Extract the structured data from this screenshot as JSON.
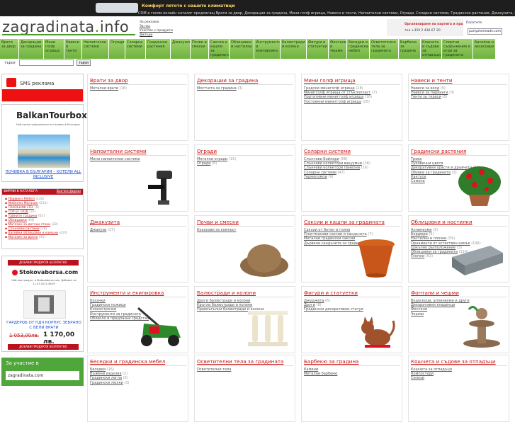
{
  "topbar": {
    "promo": "Комфорт лятото с нашите климатици",
    "strip": "COM е голям онлайн каталог предлагащ Врати за двор, Декорации за градина, Мини голф игрища, Навеси и тенти, Напоителни системи, Огради, Соларни системи, Градински растения, Джакузита, Почви и смески, Саксии и к"
  },
  "logo": {
    "main": "zagradinata",
    "dot": ".",
    "tld": "info"
  },
  "toplinks": [
    "За реклама",
    "За нас",
    "Участие с продукти",
    "Дилъри"
  ],
  "banner": {
    "t1": "Организиране на партита и празненства",
    "t2": "тел.+359 2 436 67 20",
    "r1": "Посетете",
    "r2": "partyzinemade.com"
  },
  "nav": [
    "Врати за двор",
    "Декорации за градина",
    "Мини голф игрища",
    "Навеси и тенти",
    "Напоителни системи",
    "Огради",
    "Соларни системи",
    "Градински растения",
    "Джакузита",
    "Почви и смески",
    "Саксии и кашпи за градината",
    "Облицовки и настилки",
    "Инструменти и екипировка",
    "Балюстради и колони",
    "Фигури и статуетки",
    "Фонтани и чешми",
    "Беседки и градинска мебел",
    "Осветителни тела за градината",
    "Барбекю за градина",
    "Кошчета и съдове за отпадъци",
    "Спортни съоръжения и игри за градината",
    "Басейни и аксесоари"
  ],
  "search": {
    "label": "търси",
    "button": "търси",
    "value": ""
  },
  "sidebar": {
    "sms": "SMS реклама",
    "balkan_title": "BalkanTourbox",
    "balkan_sub": "Най-ниски предложения на почивки в България",
    "balkan_link": "ПОЧИВКА В БЪЛГАРИЯ – ХОТЕЛИ ALL INCLUSIVE",
    "firms_head": "ФИРМИ В КАТАЛОГА",
    "firms_all": "Всички фирми",
    "firms": [
      {
        "name": "Перфект Мебел",
        "count": "(140)"
      },
      {
        "name": "Мебелен Магазин",
        "count": "(214)"
      },
      {
        "name": "TRADELINK LTD.",
        "count": "(8)"
      },
      {
        "name": "ТОР БГ ООД",
        "count": "(37)"
      },
      {
        "name": "Тайните градина",
        "count": "(65)"
      },
      {
        "name": "Облицовки",
        "count": "(64)"
      },
      {
        "name": "Магазин за детски стоки",
        "count": "(28)"
      },
      {
        "name": "Слънчеви системи",
        "count": "(28)"
      },
      {
        "name": "Басейни облицовки и камъни",
        "count": "(437)"
      },
      {
        "name": "Магазин за врати",
        "count": "(35)"
      }
    ],
    "stoko_btn": "ДОБАВИ ПРОДУКТИ БЕЗПЛАТНО",
    "stoko_logo": "Stokovaborsa.com",
    "stoko_sub": "Най-нов продукт в Stokovaborsa.com. Добавен на 11.07.2011 08:09",
    "stoko_title": "ГАРДЕРОБ ОТ ПДЧ КОРПУС ЗЕБРАНО С БЕЛИ ВРАТИ",
    "stoko_old": "1 053,00лв.",
    "stoko_new": "1 170,00 лв.",
    "stoko_btn2": "ДОБАВИ ПРОДУКТИ БЕЗПЛАТНО",
    "fb_title": "За участие в",
    "fb_box": "zagradinata.com"
  },
  "cards": [
    {
      "title": "Врати за двор",
      "items": [
        {
          "n": "Метални врати",
          "c": "(18)"
        }
      ]
    },
    {
      "title": "Декорации за градина",
      "items": [
        {
          "n": "Мостчета за градина",
          "c": "(3)"
        }
      ]
    },
    {
      "title": "Мини голф игрища",
      "items": [
        {
          "n": "Градски миниголф игрища",
          "c": "(28)"
        },
        {
          "n": "Минигголф игрища от стъклопласт",
          "c": "(7)"
        },
        {
          "n": "Портативни минигголф игрища",
          "c": "(16)"
        },
        {
          "n": "Постоянни минигголф игрища",
          "c": "(25)"
        }
      ]
    },
    {
      "title": "Навеси и тенти",
      "items": [
        {
          "n": "Навеси за вход",
          "c": "(5)"
        },
        {
          "n": "Навеси за паркинги",
          "c": "(3)"
        },
        {
          "n": "Тенти за тераси",
          "c": "(8)"
        }
      ]
    },
    {
      "title": "Напоителни системи",
      "items": [
        {
          "n": "Мини напоителни системи",
          "c": ""
        }
      ]
    },
    {
      "title": "Огради",
      "items": [
        {
          "n": "Метални огради",
          "c": "(15)"
        },
        {
          "n": "Огради",
          "c": "(8)"
        }
      ]
    },
    {
      "title": "Соларни системи",
      "items": [
        {
          "n": "Слънчеви Бойлери",
          "c": "(56)"
        },
        {
          "n": "Слънчеви колектори вакуумни",
          "c": "(38)"
        },
        {
          "n": "Слънчеви колектори панелни",
          "c": "(16)"
        },
        {
          "n": "Соларни системи",
          "c": "(47)"
        },
        {
          "n": "Термопомпи",
          "c": "(9)"
        }
      ]
    },
    {
      "title": "Градински растения",
      "items": [
        {
          "n": "Трева",
          "c": ""
        },
        {
          "n": "Луковични цветя",
          "c": ""
        },
        {
          "n": "Декоративни храсти и дръвчета",
          "c": "(14)"
        },
        {
          "n": "Обувки за градината",
          "c": "(3)"
        },
        {
          "n": "Кактуси",
          "c": ""
        },
        {
          "n": "Семена",
          "c": ""
        }
      ]
    },
    {
      "title": "Джакузита",
      "items": [
        {
          "n": "Джакузи",
          "c": "(27)"
        }
      ]
    },
    {
      "title": "Почви и смески",
      "items": [
        {
          "n": "Кокосови за компост",
          "c": ""
        }
      ]
    },
    {
      "title": "Саксии и кашпи за градината",
      "items": [
        {
          "n": "Саксии от бетон и глина",
          "c": ""
        },
        {
          "n": "Пластмасови саксии и сандъчета",
          "c": "(7)"
        },
        {
          "n": "Метални градински саксии",
          "c": ""
        },
        {
          "n": "Дървени сандъчета за градината",
          "c": ""
        }
      ]
    },
    {
      "title": "Облицовки и настилки",
      "items": [
        {
          "n": "Алпинеуми",
          "c": "(3)"
        },
        {
          "n": "Бордюри",
          "c": "(5)"
        },
        {
          "n": "Настилки и плочки",
          "c": "(59)"
        },
        {
          "n": "Орнаменти от естествен камък",
          "c": "(196)"
        },
        {
          "n": "Цокълно разположение",
          "c": "(3)"
        },
        {
          "n": "Облицовки за градината",
          "c": "(114)"
        },
        {
          "n": "Плочки",
          "c": "(92)"
        }
      ]
    },
    {
      "title": "Инструменти и екипировка",
      "items": [
        {
          "n": "Косачки",
          "c": ""
        },
        {
          "n": "Градински ножици",
          "c": ""
        },
        {
          "n": "Клонострачки",
          "c": ""
        },
        {
          "n": "Инструменти за градината",
          "c": ""
        },
        {
          "n": "Облекло и предпазни средства",
          "c": ""
        }
      ]
    },
    {
      "title": "Балюстради и колони",
      "items": [
        {
          "n": "Други Балюстради и колони",
          "c": ""
        },
        {
          "n": "Кръгли балюстради и колони",
          "c": ""
        },
        {
          "n": "Правоъгълни балюстради и колони",
          "c": ""
        }
      ]
    },
    {
      "title": "Фигури и статуетки",
      "items": [
        {
          "n": "Джуджета",
          "c": "(6)"
        },
        {
          "n": "Други",
          "c": "(8)"
        },
        {
          "n": "Градински декоративни статуи",
          "c": ""
        }
      ]
    },
    {
      "title": "Фонтани и чешми",
      "items": [
        {
          "n": "Водоскоци, алпинеуми и други",
          "c": ""
        },
        {
          "n": "Декоративни кладенци",
          "c": ""
        },
        {
          "n": "Фонтани",
          "c": ""
        },
        {
          "n": "Чешми",
          "c": ""
        }
      ]
    },
    {
      "title": "Беседки и градинска мебел",
      "items": [
        {
          "n": "Беседки",
          "c": "(16)"
        },
        {
          "n": "Въжени изделия",
          "c": "(2)"
        },
        {
          "n": "Градински легла",
          "c": "(5)"
        },
        {
          "n": "Градински люлки",
          "c": "(3)"
        }
      ]
    },
    {
      "title": "Осветителни тела за градината",
      "items": [
        {
          "n": "Осветителни тела",
          "c": ""
        }
      ]
    },
    {
      "title": "Барбекю за градина",
      "items": [
        {
          "n": "Камини",
          "c": ""
        },
        {
          "n": "Метални барбекю",
          "c": ""
        }
      ]
    },
    {
      "title": "Кошчета и съдове за отпадъци",
      "items": [
        {
          "n": "Кошчета за отпадъци",
          "c": ""
        },
        {
          "n": "Компостери",
          "c": ""
        },
        {
          "n": "Силози",
          "c": ""
        }
      ]
    }
  ],
  "colors": {
    "nav": "#7cc047",
    "accent": "#c8140f",
    "topbar": "#1e1e1e",
    "promo_strip": "#b9141e"
  }
}
